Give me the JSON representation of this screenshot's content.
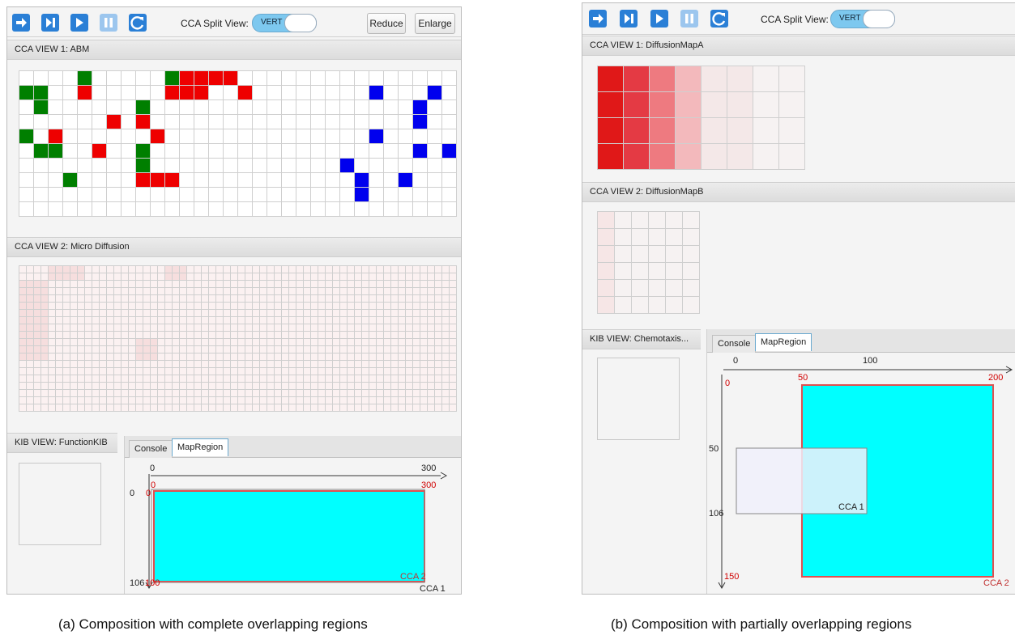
{
  "captions": {
    "a": "(a) Composition with complete overlapping regions",
    "b": "(b) Composition with partially overlapping regions"
  },
  "icons": [
    "step-forward-icon",
    "skip-end-icon",
    "play-icon",
    "pause-icon",
    "reload-icon"
  ],
  "colors": {
    "agent_green": "#007f00",
    "agent_red": "#ee0000",
    "agent_blue": "#0000ee",
    "region_cyan": "#00ffff",
    "region_border": "#e05050",
    "toolbar_blue": "#2a7fd6"
  },
  "left": {
    "toolbar": {
      "split_label": "CCA Split View:",
      "toggle_label": "VERT",
      "reduce": "Reduce",
      "enlarge": "Enlarge"
    },
    "view1": {
      "title": "CCA VIEW 1: ABM"
    },
    "view2": {
      "title": "CCA VIEW 2: Micro Diffusion"
    },
    "kib": {
      "title": "KIB VIEW: FunctionKIB"
    },
    "tabs": {
      "console": "Console",
      "mapregion": "MapRegion"
    },
    "map": {
      "x_start": "0",
      "x_end": "300",
      "x_start_red": "0",
      "x_end_red": "300",
      "y_start": "0",
      "y_start_red": "0",
      "y_end": "106",
      "y_end_red": "100",
      "region2": "CCA 2",
      "region1": "CCA 1"
    }
  },
  "right": {
    "toolbar": {
      "split_label": "CCA Split View:",
      "toggle_label": "VERT"
    },
    "view1": {
      "title": "CCA VIEW 1: DiffusionMapA"
    },
    "view2": {
      "title": "CCA VIEW 2: DiffusionMapB"
    },
    "kib": {
      "title": "KIB VIEW: Chemotaxis..."
    },
    "tabs": {
      "console": "Console",
      "mapregion": "MapRegion"
    },
    "map": {
      "x_start": "0",
      "x_mid": "100",
      "x_red_50": "50",
      "x_red_200": "200",
      "y_red_0": "0",
      "y_50": "50",
      "y_106": "106",
      "y_red_150": "150",
      "region1": "CCA 1",
      "region2": "CCA 2"
    }
  }
}
